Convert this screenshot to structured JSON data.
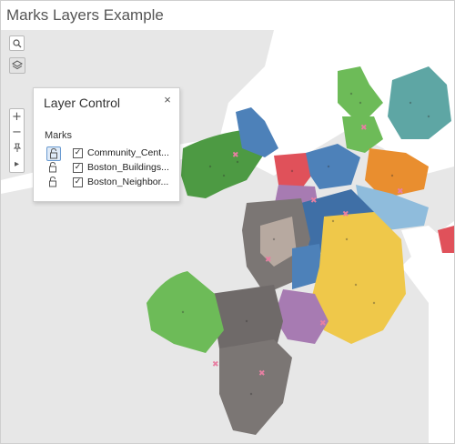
{
  "title": "Marks Layers Example",
  "toolbar": {
    "search_icon": "magnifier-icon",
    "layers_icon": "layers-icon",
    "zoom_in": "+",
    "zoom_out": "−",
    "pin": "pin-icon",
    "expand": "▸"
  },
  "layer_control": {
    "title": "Layer Control",
    "close": "×",
    "section_label": "Marks",
    "layers": [
      {
        "label": "Community_Cent...",
        "checked": true,
        "lock_icon": "unlocked-lock-icon",
        "selected": true
      },
      {
        "label": "Boston_Buildings...",
        "checked": true,
        "lock_icon": "unlocked-lock-icon",
        "selected": false
      },
      {
        "label": "Boston_Neighbor...",
        "checked": true,
        "lock_icon": "unlocked-lock-icon",
        "selected": false
      }
    ]
  },
  "colors": {
    "water": "#ffffff",
    "land": "#e7e7e7",
    "green": "#6dbb58",
    "blue": "#4d81b9",
    "teal": "#5ea6a4",
    "orange": "#e98e2f",
    "yellow": "#efc84a",
    "gray": "#7b7674",
    "purple": "#a77bb2",
    "red": "#e0515a",
    "pink": "#e77fa2",
    "lightblue": "#8fbcdc",
    "tan": "#b7a9a0"
  }
}
